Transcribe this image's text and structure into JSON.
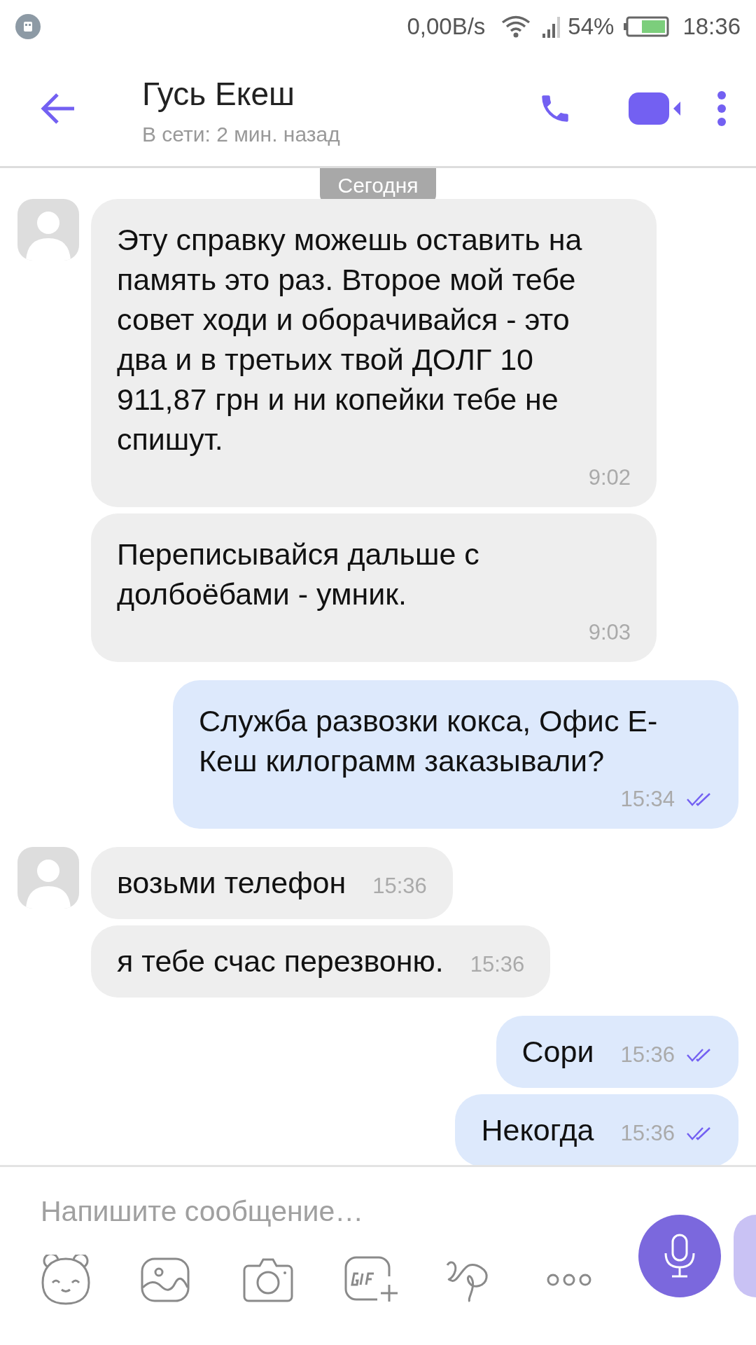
{
  "status_bar": {
    "speed": "0,00B/s",
    "battery": "54%",
    "time": "18:36"
  },
  "header": {
    "title": "Гусь Екеш",
    "subtitle": "В сети: 2 мин. назад"
  },
  "date_chip": "Сегодня",
  "messages": [
    {
      "kind": "incoming",
      "show_avatar": true,
      "text": "Эту справку можешь оставить на память это раз. Второе мой тебе совет ходи и оборачивайся - это два и в третьих твой ДОЛГ 10 911,87 грн и ни копейки тебе не спишут.",
      "time": "9:02"
    },
    {
      "kind": "incoming",
      "show_avatar": false,
      "text": "Переписывайся дальше с долбоёбами - умник.",
      "time": "9:03"
    },
    {
      "kind": "outgoing",
      "read": true,
      "text": "Служба развозки кокса, Офис Е-Кеш килограмм заказывали?",
      "time": "15:34"
    },
    {
      "kind": "incoming",
      "show_avatar": true,
      "text": "возьми телефон",
      "time": "15:36"
    },
    {
      "kind": "incoming",
      "show_avatar": false,
      "text": "я тебе счас перезвоню.",
      "time": "15:36"
    },
    {
      "kind": "outgoing",
      "read": true,
      "text": "Сори",
      "time": "15:36"
    },
    {
      "kind": "outgoing",
      "read": true,
      "text": "Некогда",
      "time": "15:36"
    }
  ],
  "composer": {
    "placeholder": "Напишите сообщение…"
  }
}
